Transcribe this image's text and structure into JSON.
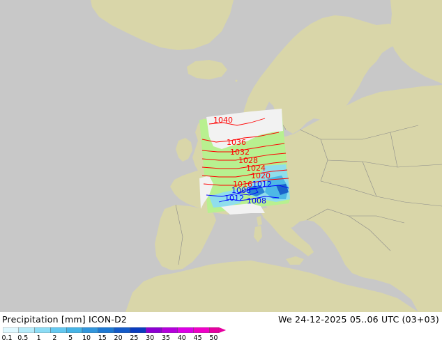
{
  "map": {
    "title": "Precipitation [mm]  ICON-D2",
    "valid_time": "We 24-12-2025 05..06 UTC (03+03)",
    "colors": {
      "sea": "#c8c8c8",
      "land": "#d9d6a9",
      "model_domain_land": "#b8f090",
      "model_domain_sea": "#f2f2f2",
      "isobar_high": "#ff0000",
      "isobar_low": "#0000ff",
      "borders": "#8a8a8a"
    },
    "isobar_labels": [
      {
        "text": "1040",
        "color": "red"
      },
      {
        "text": "1036",
        "color": "red"
      },
      {
        "text": "1032",
        "color": "red"
      },
      {
        "text": "1028",
        "color": "red"
      },
      {
        "text": "1024",
        "color": "red"
      },
      {
        "text": "1020",
        "color": "red"
      },
      {
        "text": "1016",
        "color": "red"
      },
      {
        "text": "1012",
        "color": "blue"
      },
      {
        "text": "1008",
        "color": "blue"
      },
      {
        "text": "1012",
        "color": "blue"
      },
      {
        "text": "1008",
        "color": "blue"
      }
    ]
  },
  "legend": {
    "ticks": [
      "0.1",
      "0.5",
      "1",
      "2",
      "5",
      "10",
      "15",
      "20",
      "25",
      "30",
      "35",
      "40",
      "45",
      "50"
    ],
    "colors": [
      "#dff8ff",
      "#b5ebfa",
      "#8cdcf5",
      "#64c8f0",
      "#46b4e6",
      "#3296dc",
      "#1e78d2",
      "#145ac8",
      "#0a3cbe",
      "#8c00d2",
      "#b400dc",
      "#dc00e6",
      "#f000c8",
      "#e600a0"
    ]
  }
}
